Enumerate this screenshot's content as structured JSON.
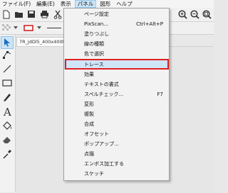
{
  "menubar": {
    "items": [
      {
        "label": "ファイル(F)",
        "active": false
      },
      {
        "label": "編集(E)",
        "active": false
      },
      {
        "label": "表示",
        "active": false
      },
      {
        "label": "パネル",
        "active": true
      },
      {
        "label": "図形",
        "active": false
      },
      {
        "label": "ヘルプ",
        "active": false
      }
    ]
  },
  "document_tab": {
    "title": "7R_jdDl5_400x400",
    "close_glyph": "×"
  },
  "panel_menu": {
    "items": [
      {
        "label": "ページ設定",
        "shortcut": ""
      },
      {
        "label": "PixScan...",
        "shortcut": "Ctrl+Alt+P"
      },
      {
        "label": "塗りつぶし",
        "shortcut": ""
      },
      {
        "label": "線の種類",
        "shortcut": ""
      },
      {
        "label": "色で選択",
        "shortcut": ""
      },
      {
        "label": "トレース",
        "shortcut": ""
      },
      {
        "label": "効果",
        "shortcut": ""
      },
      {
        "label": "テキストの書式",
        "shortcut": ""
      },
      {
        "label": "スペルチェック...",
        "shortcut": "F7"
      },
      {
        "label": "変形",
        "shortcut": ""
      },
      {
        "label": "複製",
        "shortcut": ""
      },
      {
        "label": "合成",
        "shortcut": ""
      },
      {
        "label": "オフセット",
        "shortcut": ""
      },
      {
        "label": "ポップアップ...",
        "shortcut": ""
      },
      {
        "label": "点描",
        "shortcut": ""
      },
      {
        "label": "エンボス加工する",
        "shortcut": ""
      },
      {
        "label": "スケッチ",
        "shortcut": ""
      }
    ],
    "highlighted_item": "トレース",
    "highlight_color": "#e02020"
  },
  "colors": {
    "highlight_border": "#e02020",
    "menu_active_bg": "#cce4f7",
    "stroke_color_swatch": "#d01818"
  }
}
